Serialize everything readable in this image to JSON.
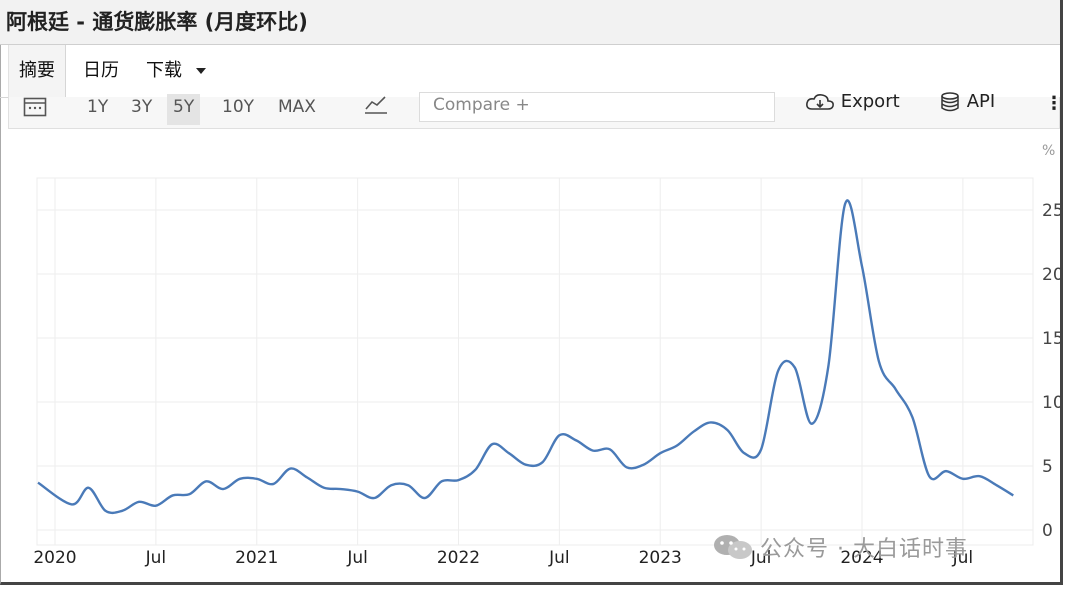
{
  "title": "阿根廷 - 通货膨胀率 (月度环比)",
  "tabs": [
    {
      "label": "摘要",
      "active": true
    },
    {
      "label": "日历",
      "active": false
    },
    {
      "label": "下载",
      "active": false
    }
  ],
  "toolbar": {
    "ranges": [
      "1Y",
      "3Y",
      "5Y",
      "10Y",
      "MAX"
    ],
    "active_range": "5Y",
    "compare_placeholder": "Compare +",
    "export_label": "Export",
    "api_label": "API"
  },
  "watermark": "公众号 · 大白话时事",
  "colors": {
    "line": "#4a7ab8",
    "grid": "#eeeeee",
    "axis_text": "#444444"
  },
  "chart_data": {
    "type": "line",
    "title": "",
    "xlabel": "",
    "ylabel": "%",
    "ylim": [
      0,
      27
    ],
    "yticks": [
      0,
      5,
      10,
      15,
      20,
      25
    ],
    "xtick_labels": [
      "2020",
      "Jul",
      "2021",
      "Jul",
      "2022",
      "Jul",
      "2023",
      "Jul",
      "2024",
      "Jul"
    ],
    "xtick_dates": [
      "2020-01",
      "2020-07",
      "2021-01",
      "2021-07",
      "2022-01",
      "2022-07",
      "2023-01",
      "2023-07",
      "2024-01",
      "2024-07"
    ],
    "grid": true,
    "series": [
      {
        "name": "",
        "x": [
          "2020-01",
          "2020-02",
          "2020-03",
          "2020-04",
          "2020-05",
          "2020-06",
          "2020-07",
          "2020-08",
          "2020-09",
          "2020-10",
          "2020-11",
          "2020-12",
          "2021-01",
          "2021-02",
          "2021-03",
          "2021-04",
          "2021-05",
          "2021-06",
          "2021-07",
          "2021-08",
          "2021-09",
          "2021-10",
          "2021-11",
          "2021-12",
          "2022-01",
          "2022-02",
          "2022-03",
          "2022-04",
          "2022-05",
          "2022-06",
          "2022-07",
          "2022-08",
          "2022-09",
          "2022-10",
          "2022-11",
          "2022-12",
          "2023-01",
          "2023-02",
          "2023-03",
          "2023-04",
          "2023-05",
          "2023-06",
          "2023-07",
          "2023-08",
          "2023-09",
          "2023-10",
          "2023-11",
          "2023-12",
          "2024-01",
          "2024-02",
          "2024-03",
          "2024-04",
          "2024-05",
          "2024-06",
          "2024-07",
          "2024-08",
          "2024-09",
          "2024-10"
        ],
        "y": [
          3.7,
          2.0,
          3.3,
          1.5,
          1.5,
          2.2,
          1.9,
          2.7,
          2.8,
          3.8,
          3.2,
          4.0,
          4.0,
          3.6,
          4.8,
          4.1,
          3.3,
          3.2,
          3.0,
          2.5,
          3.5,
          3.5,
          2.5,
          3.8,
          3.9,
          4.7,
          6.7,
          6.0,
          5.1,
          5.3,
          7.4,
          7.0,
          6.2,
          6.3,
          4.9,
          5.1,
          6.0,
          6.6,
          7.7,
          8.4,
          7.8,
          6.0,
          6.3,
          12.4,
          12.7,
          8.3,
          12.8,
          25.5,
          20.6,
          13.2,
          11.0,
          8.8,
          4.2,
          4.6,
          4.0,
          4.2,
          3.5,
          2.7
        ]
      }
    ]
  }
}
